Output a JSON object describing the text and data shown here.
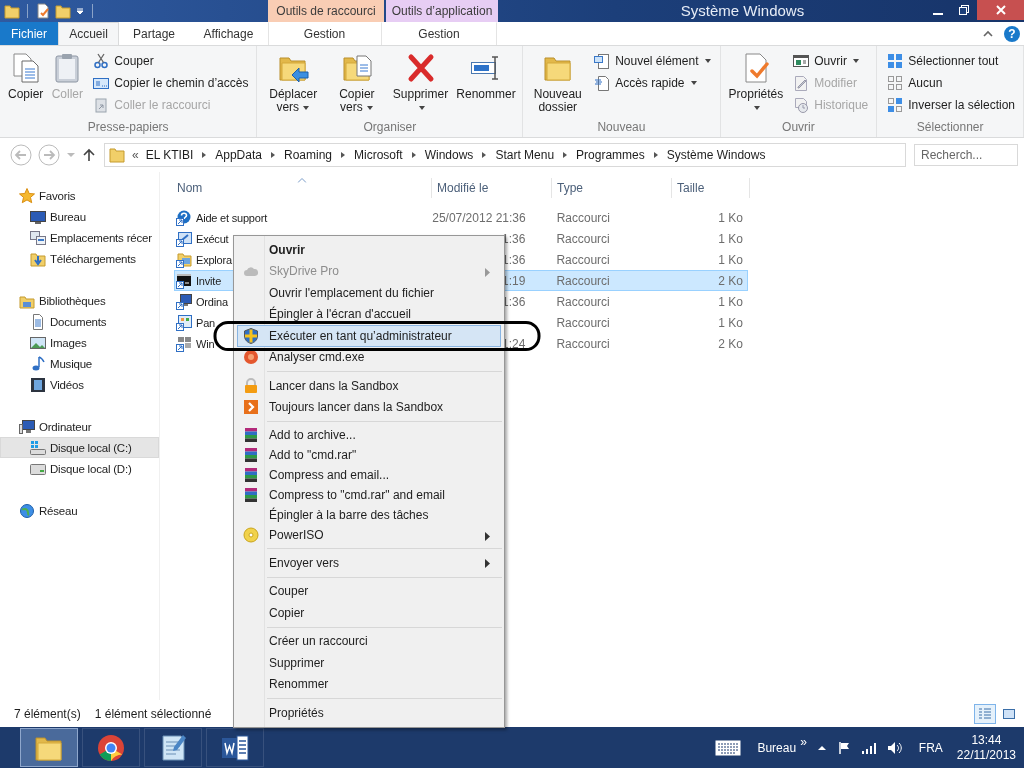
{
  "window": {
    "title": "Système Windows"
  },
  "contextual_tabs": [
    {
      "label": "Outils de raccourci",
      "color": "#f9cdb4",
      "tab": {
        "label": "Gestion",
        "selected": false
      }
    },
    {
      "label": "Outils d’application",
      "color": "#e7cdf4",
      "tab": {
        "label": "Gestion",
        "selected": false
      }
    }
  ],
  "ribbon_tabs": [
    {
      "label": "Fichier",
      "kind": "file",
      "selected": false
    },
    {
      "label": "Accueil",
      "kind": "tab",
      "selected": true
    },
    {
      "label": "Partage",
      "kind": "tab",
      "selected": false
    },
    {
      "label": "Affichage",
      "kind": "tab",
      "selected": false
    }
  ],
  "help": "?",
  "ribbon_groups": [
    {
      "label": "Presse-papiers",
      "commands": [
        {
          "label": "Copier",
          "kind": "large",
          "disabled": false,
          "dropdown": false
        },
        {
          "label": "Coller",
          "kind": "large",
          "disabled": true,
          "dropdown": false
        },
        {
          "label": "Couper",
          "kind": "small",
          "disabled": false,
          "dropdown": false
        },
        {
          "label": "Copier le chemin d’accès",
          "kind": "small",
          "disabled": false,
          "dropdown": false
        },
        {
          "label": "Coller le raccourci",
          "kind": "small",
          "disabled": true,
          "dropdown": false
        }
      ]
    },
    {
      "label": "Organiser",
      "commands": [
        {
          "label": "Déplacer vers",
          "kind": "large",
          "disabled": false,
          "dropdown": true
        },
        {
          "label": "Copier vers",
          "kind": "large",
          "disabled": false,
          "dropdown": true
        },
        {
          "label": "Supprimer",
          "kind": "large",
          "disabled": false,
          "dropdown": true
        },
        {
          "label": "Renommer",
          "kind": "large",
          "disabled": false,
          "dropdown": false
        }
      ]
    },
    {
      "label": "Nouveau",
      "commands": [
        {
          "label": "Nouveau dossier",
          "kind": "large",
          "disabled": false,
          "dropdown": false
        },
        {
          "label": "Nouvel élément",
          "kind": "small",
          "disabled": false,
          "dropdown": true
        },
        {
          "label": "Accès rapide",
          "kind": "small",
          "disabled": false,
          "dropdown": true
        }
      ]
    },
    {
      "label": "Ouvrir",
      "commands": [
        {
          "label": "Propriétés",
          "kind": "large",
          "disabled": false,
          "dropdown": true
        },
        {
          "label": "Ouvrir",
          "kind": "small",
          "disabled": false,
          "dropdown": true
        },
        {
          "label": "Modifier",
          "kind": "small",
          "disabled": true,
          "dropdown": false
        },
        {
          "label": "Historique",
          "kind": "small",
          "disabled": true,
          "dropdown": false
        }
      ]
    },
    {
      "label": "Sélectionner",
      "commands": [
        {
          "label": "Sélectionner tout",
          "kind": "small",
          "disabled": false,
          "dropdown": false
        },
        {
          "label": "Aucun",
          "kind": "small",
          "disabled": false,
          "dropdown": false
        },
        {
          "label": "Inverser la sélection",
          "kind": "small",
          "disabled": false,
          "dropdown": false
        }
      ]
    }
  ],
  "address": {
    "overflow": "«",
    "crumbs": [
      "EL KTIBI",
      "AppData",
      "Roaming",
      "Microsoft",
      "Windows",
      "Start Menu",
      "Programmes",
      "Système Windows"
    ]
  },
  "search": {
    "placeholder": "Recherch..."
  },
  "nav": [
    {
      "label": "Favoris",
      "selected": false,
      "children": [
        {
          "label": "Bureau",
          "selected": false
        },
        {
          "label": "Emplacements récer",
          "selected": false
        },
        {
          "label": "Téléchargements",
          "selected": false
        }
      ]
    },
    {
      "label": "Bibliothèques",
      "selected": false,
      "children": [
        {
          "label": "Documents",
          "selected": false
        },
        {
          "label": "Images",
          "selected": false
        },
        {
          "label": "Musique",
          "selected": false
        },
        {
          "label": "Vidéos",
          "selected": false
        }
      ]
    },
    {
      "label": "Ordinateur",
      "selected": false,
      "children": [
        {
          "label": "Disque local (C:)",
          "selected": true
        },
        {
          "label": "Disque local (D:)",
          "selected": false
        }
      ]
    },
    {
      "label": "Réseau",
      "selected": false
    }
  ],
  "columns": [
    {
      "label": "Nom",
      "sorted": true
    },
    {
      "label": "Modifié le",
      "sorted": false
    },
    {
      "label": "Type",
      "sorted": false
    },
    {
      "label": "Taille",
      "sorted": false
    }
  ],
  "rows": [
    {
      "name": "Aide et support",
      "modified": "25/07/2012 21:36",
      "type": "Raccourci",
      "size": "1 Ko",
      "selected": false
    },
    {
      "name": "Exécut",
      "modified": "1:36",
      "type": "Raccourci",
      "size": "1 Ko",
      "selected": false
    },
    {
      "name": "Explora",
      "modified": "1:36",
      "type": "Raccourci",
      "size": "1 Ko",
      "selected": false
    },
    {
      "name": "Invite",
      "modified": "1:19",
      "type": "Raccourci",
      "size": "2 Ko",
      "selected": true
    },
    {
      "name": "Ordina",
      "modified": "1:36",
      "type": "Raccourci",
      "size": "1 Ko",
      "selected": false
    },
    {
      "name": "Pan",
      "type": "Raccourci",
      "size": "1 Ko",
      "selected": false
    },
    {
      "name": "Win",
      "modified": "1:24",
      "type": "Raccourci",
      "size": "2 Ko",
      "selected": false
    }
  ],
  "context_menu": {
    "sections": [
      [
        {
          "label": "Ouvrir",
          "default": true,
          "disabled": false,
          "submenu": false,
          "selected": false
        },
        {
          "label": "SkyDrive Pro",
          "default": false,
          "disabled": true,
          "submenu": true,
          "selected": false
        },
        {
          "label": "Ouvrir l'emplacement du fichier",
          "default": false,
          "disabled": false,
          "submenu": false,
          "selected": false
        },
        {
          "label": "Épingler à l'écran d'accueil",
          "default": false,
          "disabled": false,
          "submenu": false,
          "selected": false
        },
        {
          "label": "Exécuter en tant qu’administrateur",
          "default": false,
          "disabled": false,
          "submenu": false,
          "selected": true
        },
        {
          "label": "Analyser cmd.exe",
          "default": false,
          "disabled": false,
          "submenu": false,
          "selected": false
        }
      ],
      [
        {
          "label": "Lancer dans la Sandbox",
          "default": false,
          "disabled": false,
          "submenu": false,
          "selected": false
        },
        {
          "label": "Toujours lancer dans la Sandbox",
          "default": false,
          "disabled": false,
          "submenu": false,
          "selected": false
        }
      ],
      [
        {
          "label": "Add to archive...",
          "default": false,
          "disabled": false,
          "submenu": false,
          "selected": false
        },
        {
          "label": "Add to \"cmd.rar\"",
          "default": false,
          "disabled": false,
          "submenu": false,
          "selected": false
        },
        {
          "label": "Compress and email...",
          "default": false,
          "disabled": false,
          "submenu": false,
          "selected": false
        },
        {
          "label": "Compress to \"cmd.rar\" and email",
          "default": false,
          "disabled": false,
          "submenu": false,
          "selected": false
        },
        {
          "label": "Épingler à la barre des tâches",
          "default": false,
          "disabled": false,
          "submenu": false,
          "selected": false
        },
        {
          "label": "PowerISO",
          "default": false,
          "disabled": false,
          "submenu": true,
          "selected": false
        }
      ],
      [
        {
          "label": "Envoyer vers",
          "default": false,
          "disabled": false,
          "submenu": true,
          "selected": false
        }
      ],
      [
        {
          "label": "Couper",
          "default": false,
          "disabled": false,
          "submenu": false,
          "selected": false
        },
        {
          "label": "Copier",
          "default": false,
          "disabled": false,
          "submenu": false,
          "selected": false
        }
      ],
      [
        {
          "label": "Créer un raccourci",
          "default": false,
          "disabled": false,
          "submenu": false,
          "selected": false
        },
        {
          "label": "Supprimer",
          "default": false,
          "disabled": false,
          "submenu": false,
          "selected": false
        },
        {
          "label": "Renommer",
          "default": false,
          "disabled": false,
          "submenu": false,
          "selected": false
        }
      ],
      [
        {
          "label": "Propriétés",
          "default": false,
          "disabled": false,
          "submenu": false,
          "selected": false
        }
      ]
    ]
  },
  "status_bar": {
    "count": "7 élément(s)",
    "selection": "1 élément sélectionné",
    "views": [
      {
        "selected": true
      },
      {
        "selected": false
      }
    ]
  },
  "taskbar": {
    "apps": [
      {
        "selected": true
      },
      {
        "selected": false
      },
      {
        "selected": false
      },
      {
        "selected": false
      }
    ],
    "toolbar": "Bureau",
    "chevron": "»",
    "language": "FRA",
    "time": "13:44",
    "date": "22/11/2013"
  }
}
